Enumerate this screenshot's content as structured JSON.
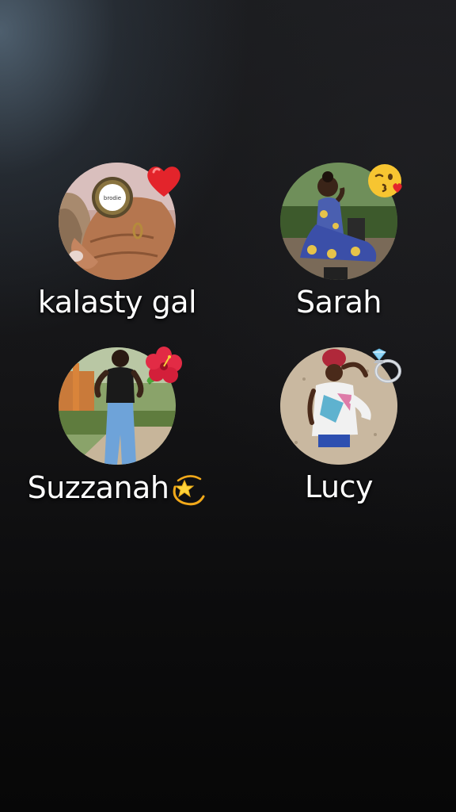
{
  "profiles": [
    {
      "name": "kalasty gal",
      "badge_icon": "red-heart-icon"
    },
    {
      "name": "Sarah",
      "badge_icon": "kissing-face-icon"
    },
    {
      "name": "Suzzanah",
      "badge_icon": "hibiscus-icon",
      "name_suffix_icon": "dizzy-star-icon"
    },
    {
      "name": "Lucy",
      "badge_icon": "diamond-ring-icon"
    }
  ],
  "colors": {
    "text": "#ffffff",
    "background_top": "#1b1c1f",
    "background_bottom": "#070707",
    "heart": "#e3242b"
  },
  "ring_inscription": "brodie"
}
